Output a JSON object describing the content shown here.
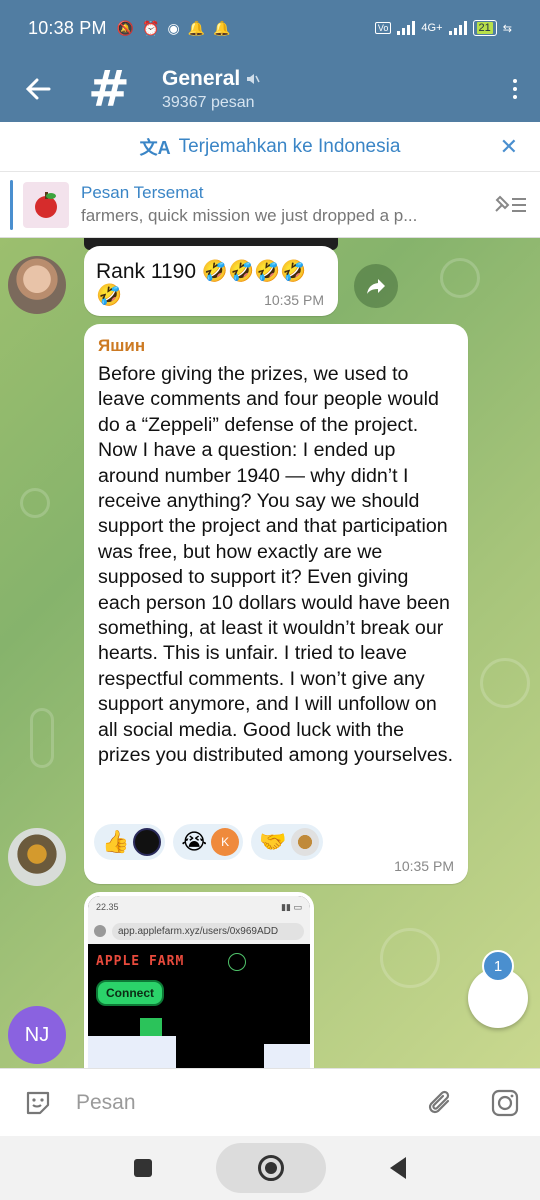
{
  "status": {
    "time": "10:38 PM",
    "network": "4G+",
    "battery": "21"
  },
  "header": {
    "title": "General",
    "subtitle": "39367 pesan",
    "avatar_glyph": "#"
  },
  "translate": {
    "label": "Terjemahkan ke Indonesia"
  },
  "pinned": {
    "title": "Pesan Tersemat",
    "preview": "farmers, quick mission   we just dropped a p..."
  },
  "messages": [
    {
      "text": "Rank 1190 🤣🤣🤣🤣🤣",
      "time": "10:35 PM"
    },
    {
      "sender": "Яшин",
      "text": "Before giving the prizes, we used to leave comments and four people would do a “Zeppeli” defense of the project. Now I have a question: I ended up around number 1940 — why didn’t I receive anything? You say we should support the project and that participation was free, but how exactly are we supposed to support it? Even giving each person 10 dollars would have been something, at least it wouldn’t break our hearts. This is unfair. I tried to leave respectful comments. I won’t give any support anymore, and I will unfollow on all social media. Good luck with the prizes you distributed among yourselves.",
      "time": "10:35 PM",
      "reactions": [
        {
          "emoji": "👍"
        },
        {
          "emoji": "😭",
          "user_initial": "K"
        },
        {
          "emoji": "🤝"
        }
      ]
    },
    {
      "screenshot": {
        "status_time": "22.35",
        "url": "app.applefarm.xyz/users/0x969ADD",
        "logo": "APPLE FARM",
        "button": "Connect"
      }
    }
  ],
  "sender_avatar_initials": "NJ",
  "unread_badge": "1",
  "composer": {
    "placeholder": "Pesan"
  },
  "colors": {
    "header": "#517da2",
    "accent": "#3a85c6",
    "sender_name": "#cc7a23"
  }
}
